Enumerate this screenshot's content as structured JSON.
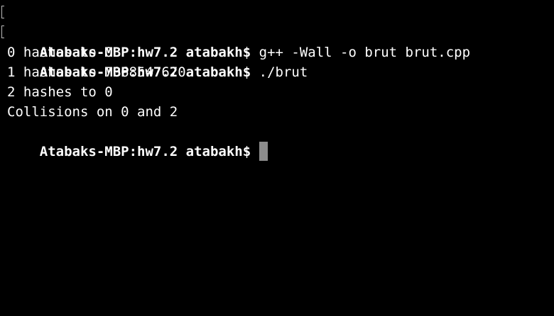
{
  "terminal": {
    "lines": [
      {
        "prompt": "Atabaks-MBP:hw7.2 atabakh$",
        "command": " g++ -Wall -o brut brut.cpp"
      },
      {
        "prompt": "Atabaks-MBP:hw7.2 atabakh$",
        "command": " ./brut"
      },
      {
        "text": "0 hashes to 0"
      },
      {
        "text": "1 hashes to 7068547670"
      },
      {
        "text": "2 hashes to 0"
      },
      {
        "text": "Collisions on 0 and 2"
      },
      {
        "prompt": "Atabaks-MBP:hw7.2 atabakh$"
      }
    ]
  },
  "colors": {
    "background": "#000000",
    "text": "#ffffff",
    "cursor": "#8c8c8c"
  }
}
